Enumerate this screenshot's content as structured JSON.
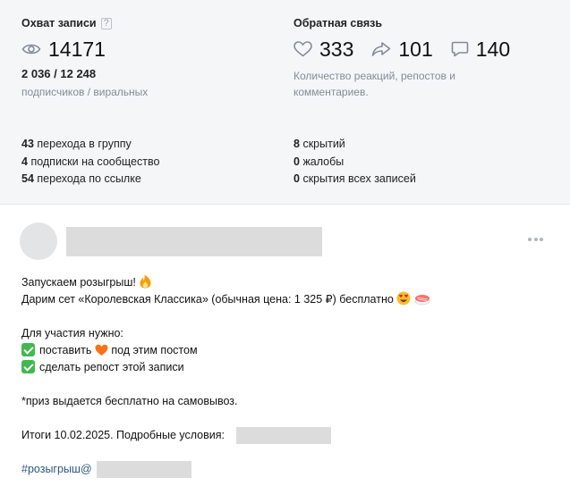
{
  "reach": {
    "title": "Охват записи",
    "help": "?",
    "views": "14171",
    "subscribers_viral": "2 036 / 12 248",
    "subscribers_viral_label": "подписчиков / виральных",
    "lines": [
      {
        "num": "43",
        "text": "перехода в группу"
      },
      {
        "num": "4",
        "text": "подписки на сообщество"
      },
      {
        "num": "54",
        "text": "перехода по ссылке"
      }
    ]
  },
  "feedback": {
    "title": "Обратная связь",
    "likes": "333",
    "reposts": "101",
    "comments": "140",
    "description": "Количество реакций, репостов и комментариев.",
    "lines": [
      {
        "num": "8",
        "text": "скрытий"
      },
      {
        "num": "0",
        "text": "жалобы"
      },
      {
        "num": "0",
        "text": "скрытия всех записей"
      }
    ]
  },
  "post": {
    "line1": "Запускаем розыгрыш!",
    "line2": "Дарим сет «Королевская Классика» (обычная цена: 1 325 ₽) бесплатно",
    "line3": "Для участия нужно:",
    "item1_a": "поставить",
    "item1_b": "под этим постом",
    "item2": "сделать репост этой записи",
    "line4": "*приз выдается бесплатно на самовывоз.",
    "line5": "Итоги 10.02.2025. Подробные условия:",
    "hashtag": "#розыгрыш@"
  },
  "colors": {
    "stats_bg": "#f5f6f8",
    "muted": "#818c99",
    "link": "#2a5885",
    "check": "#3fb950"
  }
}
